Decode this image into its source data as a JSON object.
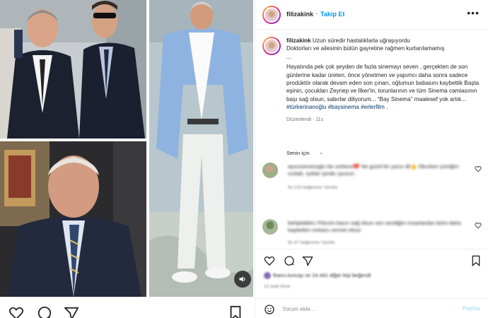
{
  "post": {
    "username": "filizakink",
    "follow_label": "Takip Et",
    "more_label": "•••",
    "caption_line1": "Uzun süredir hastalıklarla uğraşıyordu",
    "caption_line2": "Doktorları ve ailesinin bütün gayretine rağmen kurtarılamamış",
    "caption_line3": "...",
    "caption_body": "Hayatında pek çok şeyden de fazla sinemayı seven , gerçekten de son günlerine kadar üreten, önce yönetmen ve yapımcı daha sonra sadece prodüktör olarak devam eden son çınarı, oğlumun babasını kaybettik Başta eşinin, çocukları Zeynep ve İlker'in, torunlarının ve tüm Sinema camiasının başı sağ olsun, sabırlar diliyorum... “Bay Sinema” maalesef yok artık...",
    "hashtags": "#türkerinanoğlu #baysinema #erlerfilm .",
    "edited_label": "Düzenlendi",
    "edited_time": "11s",
    "for_you_label": "Senin için"
  },
  "comments": [
    {
      "text": "aysusooranoglu Ne zorbora💔 Ne güzel bir yazın dil👍 Okurken yüreğim sızladı, Işıklar içinde uyusun.",
      "meta": "9s   133 beğenme   Yanıtla"
    },
    {
      "text": "behijebilek1 Filizcim basın sağ olsun son sevdiğim insanlardan birini daha kaybettim mekanı cennet olsun",
      "meta": "9s   47 beğenme   Yanıtla"
    }
  ],
  "likes_text": "feanu.tuncay ve 24.441 diğer kişi beğendi",
  "time_ago": "12 saat önce",
  "add_comment": {
    "placeholder": "Yorum ekle...",
    "post_label": "Paylaş"
  },
  "icons": {
    "heart": "heart-icon",
    "comment": "comment-icon",
    "share": "share-icon",
    "save": "bookmark-icon",
    "emoji": "emoji-icon",
    "sound": "speaker-icon"
  },
  "colors": {
    "link_blue": "#0095f6",
    "hashtag_blue": "#00376b",
    "muted": "#737373",
    "post_disabled": "#b2dffc"
  }
}
